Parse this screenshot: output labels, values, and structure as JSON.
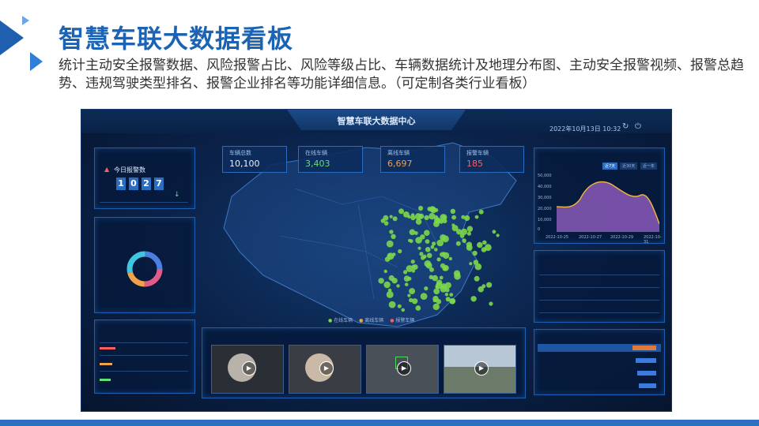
{
  "slide": {
    "title": "智慧车联大数据看板",
    "description": "统计主动安全报警数据、风险报警占比、风险等级占比、车辆数据统计及地理分布图、主动安全报警视频、报警总趋势、违规驾驶类型排名、报警企业排名等功能详细信息。（可定制各类行业看板）"
  },
  "dashboard": {
    "title": "智慧车联大数据中心",
    "datetime": "2022年10月13日 10:32",
    "stats": [
      {
        "label": "车辆总数",
        "value": "10,100",
        "color": "#e8f1ff"
      },
      {
        "label": "在线车辆",
        "value": "3,403",
        "color": "#5fe07a"
      },
      {
        "label": "离线车辆",
        "value": "6,697",
        "color": "#f0a248"
      },
      {
        "label": "报警车辆",
        "value": "185",
        "color": "#ff5d5d"
      }
    ],
    "today_alarm": {
      "label": "今日报警数",
      "digits": [
        "1",
        "0",
        "2",
        "7"
      ]
    },
    "trend": {
      "tabs": [
        "近7天",
        "近30天",
        "近一年"
      ],
      "y_ticks": [
        "50,000",
        "40,000",
        "30,000",
        "20,000",
        "10,000",
        "0"
      ],
      "x_ticks": [
        "2022-10-25",
        "2022-10-27",
        "2022-10-29",
        "2022-10-31"
      ]
    },
    "map_legend": [
      "在线车辆",
      "离线车辆",
      "报警车辆"
    ],
    "colors": {
      "online": "#7cd74a",
      "accent": "#2b6dbf",
      "alarm": "#ff5d5d",
      "warn": "#f0a248",
      "area": "#8a5ab8",
      "trend_line": "#f0b33c"
    }
  }
}
